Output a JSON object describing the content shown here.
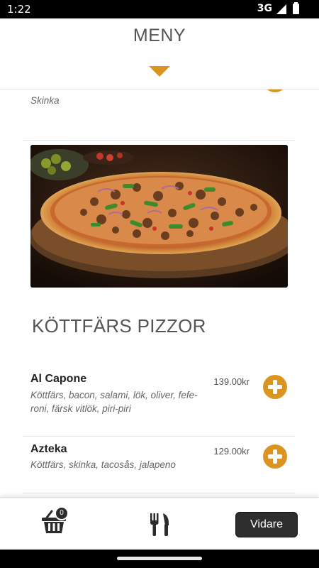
{
  "status_bar": {
    "time": "1:22",
    "network": "3G"
  },
  "header": {
    "title": "MENY"
  },
  "menu": {
    "partial_item": {
      "description": "Skinka"
    },
    "section_title": "KÖTTFÄRS PIZZOR",
    "items": [
      {
        "name": "Al Capone",
        "description": "Köttfärs, bacon, salami, lök, oliver, fefe-roni, färsk vitlök, piri-piri",
        "price": "139.00kr"
      },
      {
        "name": "Azteka",
        "description": "Köttfärs, skinka, tacosås, jalapeno",
        "price": "129.00kr"
      }
    ]
  },
  "bottom_bar": {
    "cart_count": "0",
    "next_label": "Vidare"
  },
  "colors": {
    "accent": "#dc9420",
    "button_dark": "#2e2e2e"
  }
}
